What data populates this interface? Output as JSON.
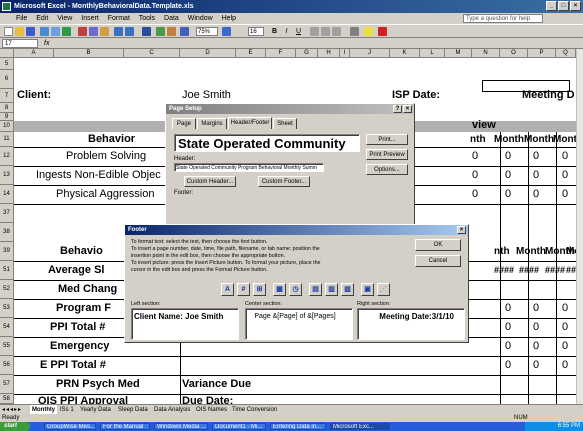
{
  "window": {
    "title": "Microsoft Excel - MonthlyBehavioralData.Template.xls",
    "min": "_",
    "max": "□",
    "close": "×"
  },
  "menu": {
    "items": [
      "File",
      "Edit",
      "View",
      "Insert",
      "Format",
      "Tools",
      "Data",
      "Window",
      "Help"
    ],
    "ask_placeholder": "Type a question for help"
  },
  "toolbar": {
    "zoom": "75%",
    "font_size": "16"
  },
  "formula": {
    "namebox": "17",
    "fx": "fx"
  },
  "columns": [
    "A",
    "B",
    "C",
    "D",
    "E",
    "F",
    "G",
    "H",
    "I",
    "J",
    "K",
    "L",
    "M",
    "N",
    "O",
    "P",
    "Q",
    "R"
  ],
  "rows": [
    "5",
    "6",
    "7",
    "8",
    "9",
    "10",
    "11",
    "12",
    "13",
    "14",
    "37",
    "38",
    "39",
    "51",
    "52",
    "53",
    "54",
    "55",
    "56",
    "57",
    "58"
  ],
  "sheet": {
    "client_label": "Client:",
    "client_name": "Joe Smith",
    "isp_label": "ISP Date:",
    "meeting_label": "Meeting D",
    "view_label": "view",
    "month_header": [
      "nth",
      "Month",
      "Month",
      "Month",
      "Mont"
    ],
    "month_header2": [
      "nth",
      "Month",
      "Month",
      "Mont"
    ],
    "behavior_header": "Behavior",
    "behaviors": [
      "Problem Solving",
      "Ingests Non-Edible Objec",
      "Physical Aggression"
    ],
    "behavior_header2": "Behavio",
    "lower_rows": [
      "Average Sl",
      "Med Chang",
      "Program F",
      "PPI Total #",
      "Emergency",
      "E PPI Total #",
      "PRN Psych Med",
      "OIS PPI Approval"
    ],
    "variance_label": "Variance Due",
    "due_label": "Due Date:",
    "zero": "0",
    "hash": "####",
    "hash3": "###"
  },
  "page_setup": {
    "title": "Page Setup",
    "tabs": [
      "Page",
      "Margins",
      "Header/Footer",
      "Sheet"
    ],
    "header_preview": "State Operated Community",
    "header_label": "Header:",
    "header_value": "State Operated Community Program Behavioral Monthly Summ",
    "footer_label": "Footer:",
    "custom_header": "Custom Header...",
    "custom_footer": "Custom Footer...",
    "print": "Print...",
    "print_preview": "Print Preview",
    "options": "Options...",
    "help": "?",
    "close": "×"
  },
  "footer_dialog": {
    "title": "Footer",
    "close": "×",
    "instructions": [
      "To format text:  select the text, then choose the font button.",
      "To insert a page number, date, time, file path, filename, or tab name:  position the",
      "     insertion point in the edit box, then choose the appropriate button.",
      "To insert picture: press the Insert Picture button.  To format your picture, place the",
      "     cursor in the edit box and press the Format Picture button."
    ],
    "ok": "OK",
    "cancel": "Cancel",
    "left_label": "Left section:",
    "center_label": "Center section:",
    "right_label": "Right section:",
    "left_value": "Client Name: Joe Smith",
    "center_value": "Page &[Page] of &[Pages]",
    "right_value": "Meeting Date:3/1/10"
  },
  "sheet_tabs": [
    "Monthly",
    "ISs 1",
    "Yearly Data",
    "Sleep Data",
    "Data Analysis",
    "OIS Names",
    "Time Conversion"
  ],
  "status": {
    "ready": "Ready",
    "num": "NUM"
  },
  "taskbar": {
    "start": "start",
    "items": [
      "GroupWise Mes...",
      "For the Manual",
      "Windows Media ...",
      "Document1 - Mi...",
      "Entering Data in...",
      "Microsoft Exc..."
    ],
    "clock": "6:55 PM"
  },
  "colors": {
    "title_bar": "#0a246a",
    "taskbar": "#245edb",
    "dialog": "#d4d0c8"
  }
}
